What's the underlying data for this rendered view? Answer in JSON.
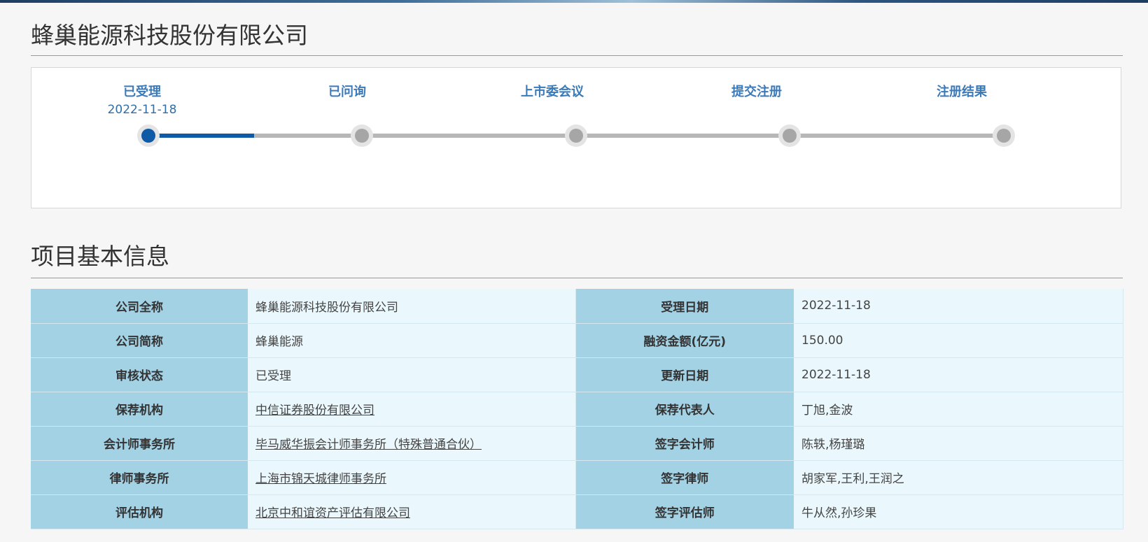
{
  "company_name": "蜂巢能源科技股份有限公司",
  "progress": {
    "steps": [
      {
        "label": "已受理",
        "date": "2022-11-18",
        "active": true
      },
      {
        "label": "已问询",
        "date": "",
        "active": false
      },
      {
        "label": "上市委会议",
        "date": "",
        "active": false
      },
      {
        "label": "提交注册",
        "date": "",
        "active": false
      },
      {
        "label": "注册结果",
        "date": "",
        "active": false
      }
    ],
    "colors": {
      "active": "#0e5aa7",
      "inactive": "#a6a6a6",
      "label": "#3a7ab9"
    }
  },
  "section_title": "项目基本信息",
  "info_rows": [
    {
      "l1": "公司全称",
      "v1": "蜂巢能源科技股份有限公司",
      "l2": "受理日期",
      "v2": "2022-11-18"
    },
    {
      "l1": "公司简称",
      "v1": "蜂巢能源",
      "l2": "融资金额(亿元)",
      "v2": "150.00"
    },
    {
      "l1": "审核状态",
      "v1": "已受理",
      "l2": "更新日期",
      "v2": "2022-11-18"
    },
    {
      "l1": "保荐机构",
      "v1": "中信证券股份有限公司",
      "l2": "保荐代表人",
      "v2": "丁旭,金波"
    },
    {
      "l1": "会计师事务所",
      "v1": "毕马威华振会计师事务所（特殊普通合伙）",
      "l2": "签字会计师",
      "v2": "陈轶,杨瑾璐"
    },
    {
      "l1": "律师事务所",
      "v1": "上海市锦天城律师事务所",
      "l2": "签字律师",
      "v2": "胡家军,王利,王润之"
    },
    {
      "l1": "评估机构",
      "v1": "北京中和谊资产评估有限公司",
      "l2": "签字评估师",
      "v2": "牛从然,孙珍果"
    }
  ]
}
